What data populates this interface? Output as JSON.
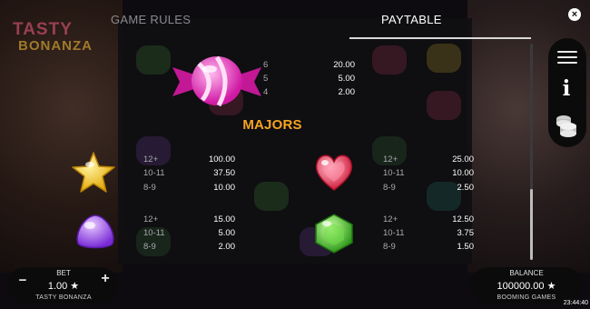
{
  "tabs": {
    "rules": "GAME RULES",
    "paytable": "PAYTABLE"
  },
  "close_symbol": "×",
  "logo": {
    "line1": "TASTY",
    "line2": "BONANZA"
  },
  "section_title": "MAJORS",
  "symbols": {
    "candy": {
      "icon": "pink-wrapped-candy-icon",
      "rows": [
        {
          "count": "6",
          "payout": "20.00"
        },
        {
          "count": "5",
          "payout": "5.00"
        },
        {
          "count": "4",
          "payout": "2.00"
        }
      ]
    },
    "star": {
      "icon": "yellow-star-candy-icon",
      "rows": [
        {
          "count": "12+",
          "payout": "100.00"
        },
        {
          "count": "10-11",
          "payout": "37.50"
        },
        {
          "count": "8-9",
          "payout": "10.00"
        }
      ]
    },
    "heart": {
      "icon": "red-heart-candy-icon",
      "rows": [
        {
          "count": "12+",
          "payout": "25.00"
        },
        {
          "count": "10-11",
          "payout": "10.00"
        },
        {
          "count": "8-9",
          "payout": "2.50"
        }
      ]
    },
    "purple": {
      "icon": "purple-gumdrop-candy-icon",
      "rows": [
        {
          "count": "12+",
          "payout": "15.00"
        },
        {
          "count": "10-11",
          "payout": "5.00"
        },
        {
          "count": "8-9",
          "payout": "2.00"
        }
      ]
    },
    "green": {
      "icon": "green-hexagon-candy-icon",
      "rows": [
        {
          "count": "12+",
          "payout": "12.50"
        },
        {
          "count": "10-11",
          "payout": "3.75"
        },
        {
          "count": "8-9",
          "payout": "1.50"
        }
      ]
    }
  },
  "side_menu": {
    "menu_icon": "hamburger-menu-icon",
    "info_icon": "info-icon",
    "info_glyph": "i",
    "coins_icon": "coin-stack-icon"
  },
  "bet": {
    "label": "BET",
    "value": "1.00 ★",
    "minus": "−",
    "plus": "+",
    "game_name": "TASTY BONANZA"
  },
  "balance": {
    "label": "BALANCE",
    "value": "100000.00 ★",
    "company": "BOOMING GAMES"
  },
  "clock": "23:44:40",
  "colors": {
    "accent": "#f7a521",
    "text_muted": "#a9a9ad",
    "background": "#0d0b0f"
  }
}
